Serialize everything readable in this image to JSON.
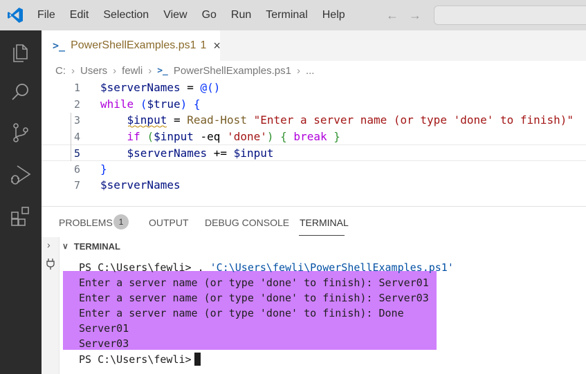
{
  "menu": [
    "File",
    "Edit",
    "Selection",
    "View",
    "Go",
    "Run",
    "Terminal",
    "Help"
  ],
  "tab": {
    "title": "PowerShellExamples.ps1",
    "problem_count": "1"
  },
  "breadcrumb": {
    "drive": "C:",
    "users": "Users",
    "user": "fewli",
    "file": "PowerShellExamples.ps1",
    "more": "..."
  },
  "editor": {
    "line_numbers": [
      "1",
      "2",
      "3",
      "4",
      "5",
      "6",
      "7"
    ],
    "active_line": "5",
    "lines": [
      "$serverNames = @()",
      "while ($true) {",
      "    $input = Read-Host \"Enter a server name (or type 'done' to finish)\"",
      "    if ($input -eq 'done') { break }",
      "    $serverNames += $input",
      "}",
      "$serverNames"
    ]
  },
  "panel": {
    "tabs": [
      "PROBLEMS",
      "OUTPUT",
      "DEBUG CONSOLE",
      "TERMINAL"
    ],
    "active_tab": "TERMINAL",
    "problems_badge": "1",
    "section_title": "TERMINAL"
  },
  "terminal": {
    "prompt": "PS C:\\Users\\fewli> ",
    "command_prefix": ". ",
    "command_path": "'C:\\Users\\fewli\\PowerShellExamples.ps1'",
    "output": [
      "Enter a server name (or type 'done' to finish): Server01",
      "Enter a server name (or type 'done' to finish): Server03",
      "Enter a server name (or type 'done' to finish): Done",
      "Server01",
      "Server03"
    ],
    "final_prompt": "PS C:\\Users\\fewli>"
  },
  "colors": {
    "highlight": "#cf80fb",
    "activity_bar": "#2c2c2c",
    "accent_blue": "#2a6fb5"
  },
  "icons": [
    "vscode-logo-icon",
    "back-arrow-icon",
    "forward-arrow-icon",
    "explorer-icon",
    "search-icon",
    "source-control-icon",
    "run-debug-icon",
    "extensions-icon",
    "powershell-icon",
    "close-icon",
    "chevron-right-icon",
    "chevron-down-icon",
    "plug-icon"
  ]
}
